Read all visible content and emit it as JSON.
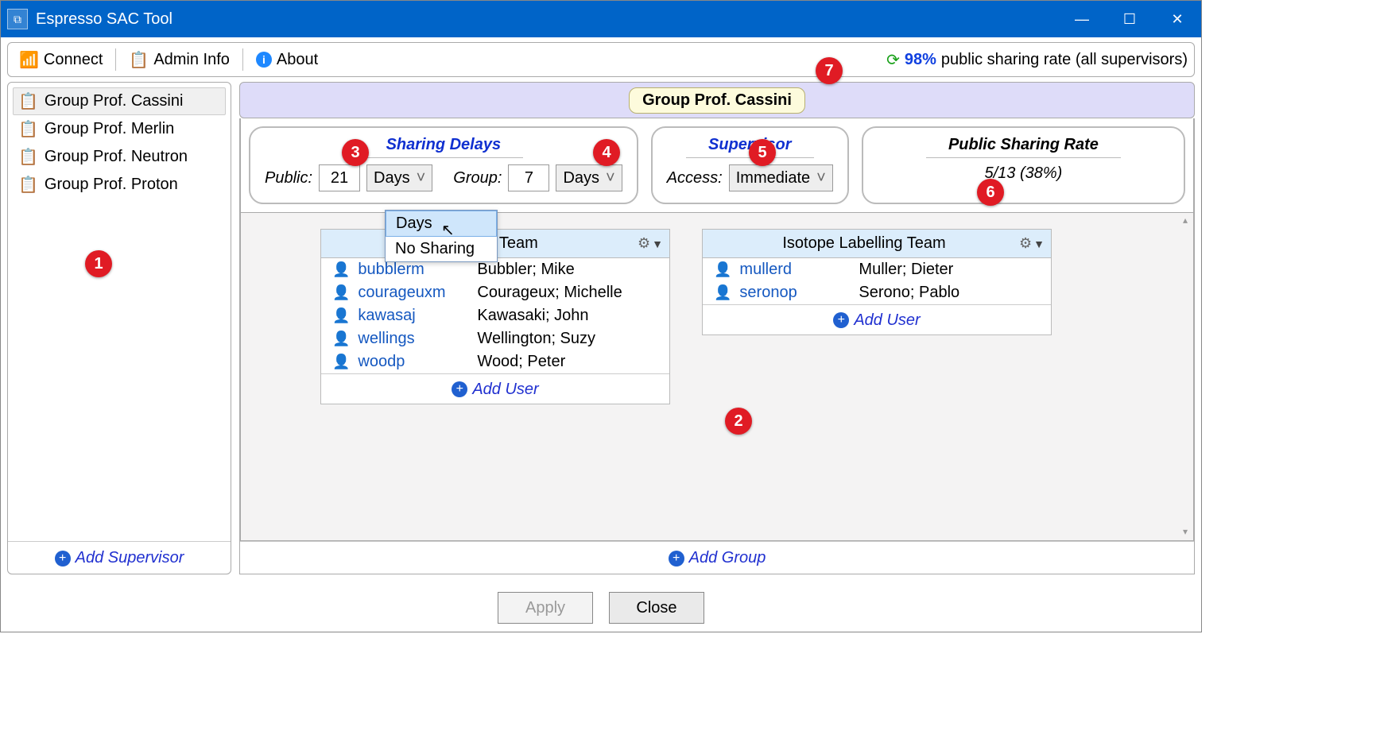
{
  "app": {
    "title": "Espresso SAC Tool"
  },
  "toolbar": {
    "connect": "Connect",
    "admin": "Admin Info",
    "about": "About",
    "rate_pct": "98%",
    "rate_text": "public sharing rate (all supervisors)"
  },
  "sidebar": {
    "items": [
      {
        "label": "Group Prof. Cassini",
        "selected": true
      },
      {
        "label": "Group Prof. Merlin",
        "selected": false
      },
      {
        "label": "Group Prof. Neutron",
        "selected": false
      },
      {
        "label": "Group Prof. Proton",
        "selected": false
      }
    ],
    "add": "Add Supervisor"
  },
  "group": {
    "title": "Group Prof. Cassini",
    "sharing_delays": {
      "legend": "Sharing Delays",
      "public_label": "Public:",
      "public_value": "21",
      "public_unit": "Days",
      "group_label": "Group:",
      "group_value": "7",
      "group_unit": "Days"
    },
    "supervisor": {
      "legend": "Supervisor",
      "access_label": "Access:",
      "access_value": "Immediate"
    },
    "psr": {
      "legend": "Public Sharing Rate",
      "value": "5/13 (38%)"
    },
    "add_group": "Add Group"
  },
  "dropdown": {
    "opt1": "Days",
    "opt2": "No Sharing"
  },
  "teams": [
    {
      "name": "Research Team",
      "users": [
        {
          "id": "bubblerm",
          "full": "Bubbler; Mike"
        },
        {
          "id": "courageuxm",
          "full": "Courageux; Michelle"
        },
        {
          "id": "kawasaj",
          "full": "Kawasaki; John"
        },
        {
          "id": "wellings",
          "full": "Wellington; Suzy"
        },
        {
          "id": "woodp",
          "full": "Wood; Peter"
        }
      ],
      "add": "Add User"
    },
    {
      "name": "Isotope Labelling Team",
      "users": [
        {
          "id": "mullerd",
          "full": "Muller; Dieter"
        },
        {
          "id": "seronop",
          "full": "Serono; Pablo"
        }
      ],
      "add": "Add User"
    }
  ],
  "buttons": {
    "apply": "Apply",
    "close": "Close"
  },
  "callouts": {
    "c1": "1",
    "c2": "2",
    "c3": "3",
    "c4": "4",
    "c5": "5",
    "c6": "6",
    "c7": "7"
  }
}
